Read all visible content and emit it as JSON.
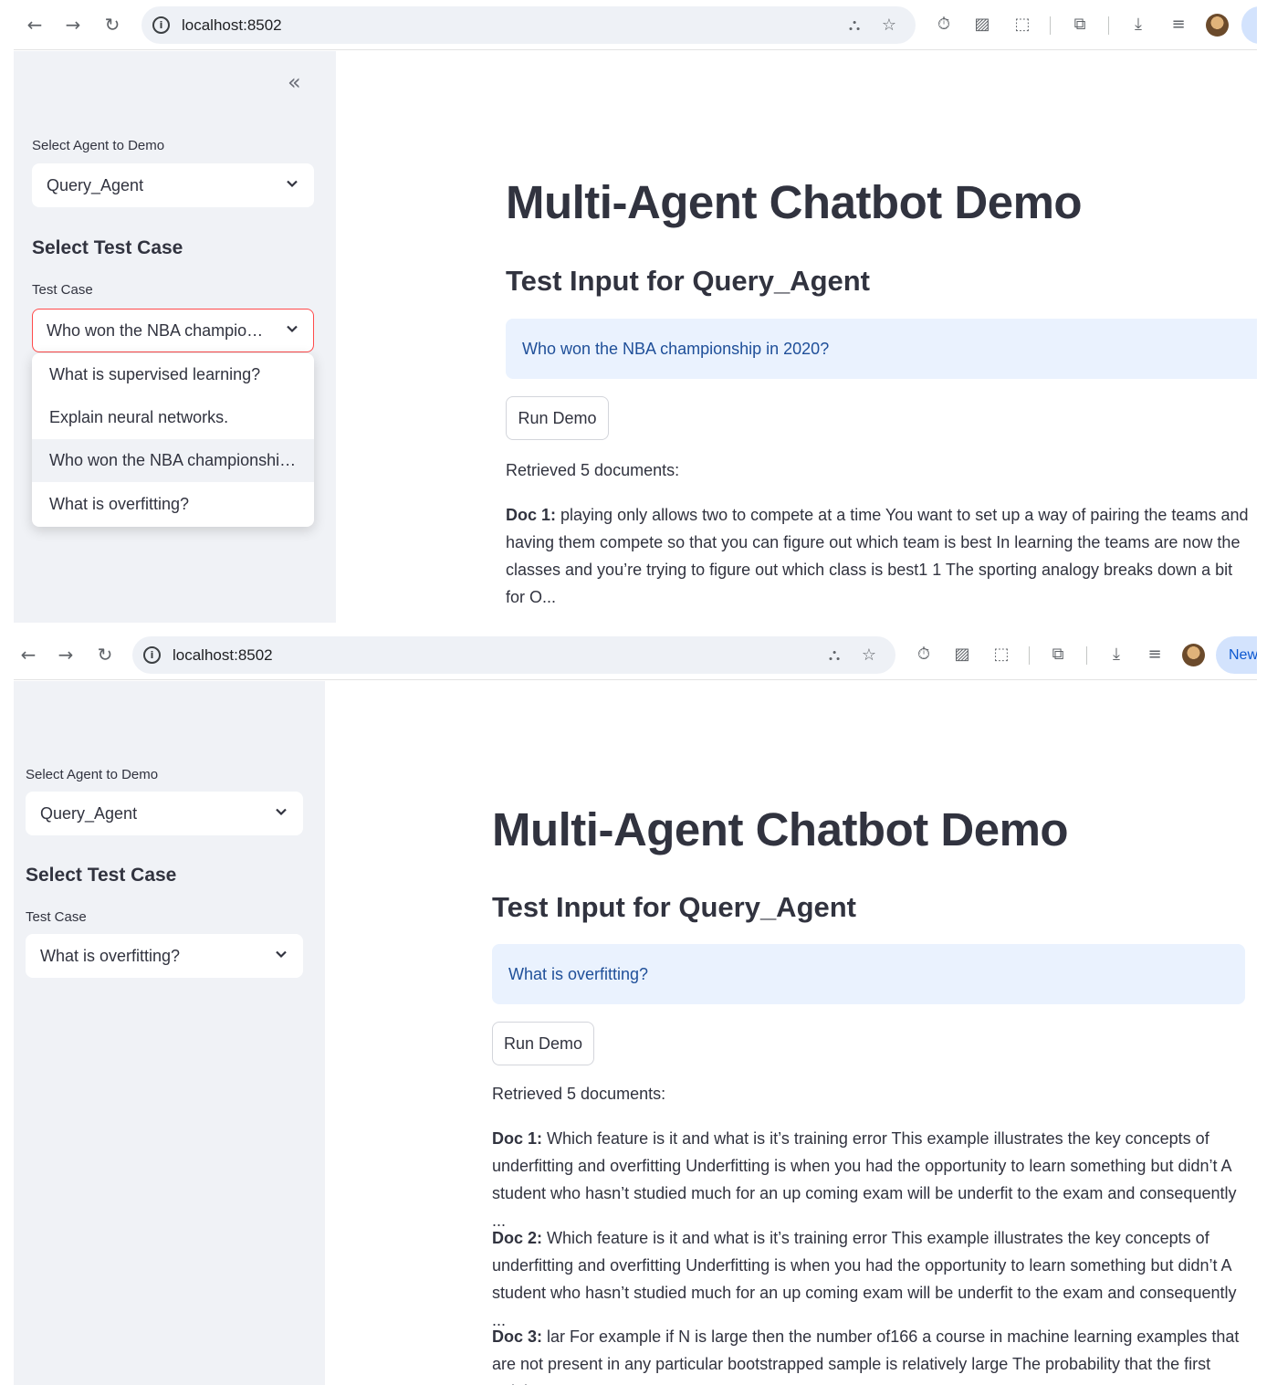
{
  "browser": {
    "url": "localhost:8502",
    "new_button_label": "New"
  },
  "sidebar": {
    "agent_select_label": "Select Agent to Demo",
    "agent_selected": "Query_Agent",
    "test_case_heading": "Select Test Case",
    "test_case_label": "Test Case"
  },
  "screen1": {
    "test_case_selected": "Who won the NBA champio…",
    "dropdown_options": [
      "What is supervised learning?",
      "Explain neural networks.",
      "Who won the NBA championshi…",
      "What is overfitting?"
    ],
    "page_title": "Multi-Agent Chatbot Demo",
    "subtitle": "Test Input for Query_Agent",
    "test_input": "Who won the NBA championship in 2020?",
    "run_button": "Run Demo",
    "retrieved_text": "Retrieved 5 documents:",
    "docs": [
      {
        "label": "Doc 1:",
        "text": "playing only allows two to compete at a time You want to set up a way of pairing the teams and having them compete so that you can figure out which team is best In learning the teams are now the classes and you’re trying to figure out which class is best1 1 The sporting analogy breaks down a bit for O..."
      }
    ]
  },
  "screen2": {
    "test_case_selected": "What is overfitting?",
    "page_title": "Multi-Agent Chatbot Demo",
    "subtitle": "Test Input for Query_Agent",
    "test_input": "What is overfitting?",
    "run_button": "Run Demo",
    "retrieved_text": "Retrieved 5 documents:",
    "docs": [
      {
        "label": "Doc 1:",
        "text": "Which feature is it and what is it’s training error This example illustrates the key concepts of underfitting and overfitting Underfitting is when you had the opportunity to learn something but didn’t A student who hasn’t studied much for an up coming exam will be underfit to the exam and consequently ..."
      },
      {
        "label": "Doc 2:",
        "text": "Which feature is it and what is it’s training error This example illustrates the key concepts of underfitting and overfitting Underfitting is when you had the opportunity to learn something but didn’t A student who hasn’t studied much for an up coming exam will be underfit to the exam and consequently ..."
      },
      {
        "label": "Doc 3:",
        "text": "lar For example if N is large then the number of166 a course in machine learning examples that are not present in any particular bootstrapped sample is relatively large The probability that the first training"
      }
    ]
  },
  "icons": {
    "back": "arrow-left-icon",
    "forward": "arrow-right-icon",
    "reload": "reload-icon",
    "info": "info-icon",
    "translate": "translate-icon",
    "bookmark": "star-icon",
    "timer": "timer-icon",
    "extension_a": "extension-icon",
    "extensions": "puzzle-icon",
    "cast": "cast-search-icon",
    "download": "download-icon",
    "playlist": "media-controls-icon",
    "profile": "avatar",
    "collapse": "double-chevron-left-icon",
    "chevron": "chevron-down-icon"
  },
  "colors": {
    "sidebar_bg": "#f0f2f6",
    "info_bg": "#eaf2fe",
    "info_text": "#1f4f99",
    "focus_border": "#ff4b4b",
    "text": "#31333f"
  }
}
